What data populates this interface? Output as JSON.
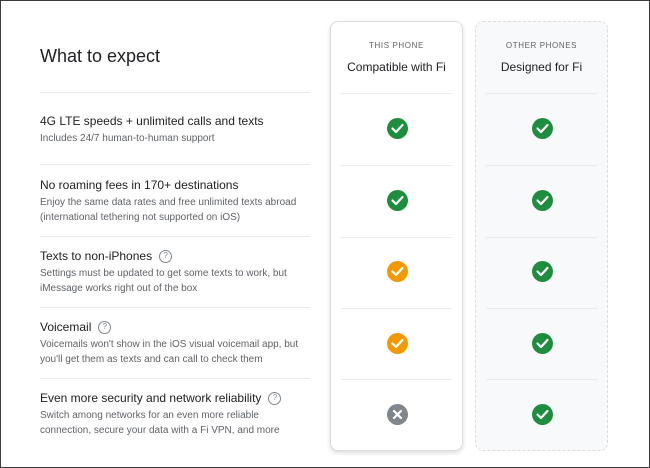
{
  "title": "What to expect",
  "columns": [
    {
      "eyebrow": "THIS PHONE",
      "name": "Compatible with Fi"
    },
    {
      "eyebrow": "OTHER PHONES",
      "name": "Designed for Fi"
    }
  ],
  "features": [
    {
      "title": "4G LTE speeds + unlimited calls and texts",
      "desc": [
        "Includes 24/7 human-to-human support"
      ],
      "help": false,
      "this_phone": "check",
      "other_phones": "check"
    },
    {
      "title": "No roaming fees in 170+ destinations",
      "desc": [
        "Enjoy the same data rates and free unlimited texts abroad",
        "(international tethering not supported on iOS)"
      ],
      "help": false,
      "this_phone": "check",
      "other_phones": "check"
    },
    {
      "title": "Texts to non-iPhones",
      "desc": [
        "Settings must be updated to get some texts to work, but",
        "iMessage works right out of the box"
      ],
      "help": true,
      "this_phone": "partial",
      "other_phones": "check"
    },
    {
      "title": "Voicemail",
      "desc": [
        "Voicemails won't show in the iOS visual voicemail app, but",
        "you'll get them as texts and can call to check them"
      ],
      "help": true,
      "this_phone": "partial",
      "other_phones": "check"
    },
    {
      "title": "Even more security and network reliability",
      "desc": [
        "Switch among networks for an even more reliable",
        "connection, secure your data with a Fi VPN, and more"
      ],
      "help": true,
      "this_phone": "unsupported",
      "other_phones": "check"
    }
  ],
  "help_glyph": "?",
  "colors": {
    "check": "#1e8e3e",
    "partial": "#f29900",
    "unsupported": "#80868b"
  }
}
